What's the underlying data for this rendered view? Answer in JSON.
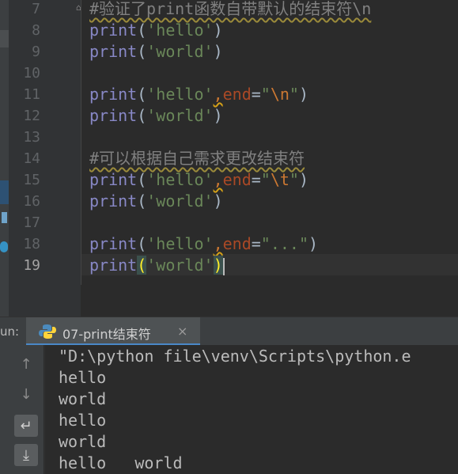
{
  "editor": {
    "lines": [
      {
        "num": "7",
        "parts": [
          {
            "t": "#验证了print函数自带默认的结束符\\n",
            "c": "cmt"
          }
        ]
      },
      {
        "num": "8",
        "parts": [
          {
            "t": "print",
            "c": "kw"
          },
          {
            "t": "(",
            "c": "par"
          },
          {
            "t": "'hello'",
            "c": "str"
          },
          {
            "t": ")",
            "c": "par"
          }
        ]
      },
      {
        "num": "9",
        "parts": [
          {
            "t": "print",
            "c": "kw"
          },
          {
            "t": "(",
            "c": "par"
          },
          {
            "t": "'world'",
            "c": "str"
          },
          {
            "t": ")",
            "c": "par"
          }
        ]
      },
      {
        "num": "10",
        "parts": []
      },
      {
        "num": "11",
        "parts": [
          {
            "t": "print",
            "c": "kw"
          },
          {
            "t": "(",
            "c": "par"
          },
          {
            "t": "'hello'",
            "c": "str"
          },
          {
            "t": ",",
            "c": "wavy-comma"
          },
          {
            "t": "end",
            "c": "prm"
          },
          {
            "t": "=",
            "c": "par"
          },
          {
            "t": "\"",
            "c": "str"
          },
          {
            "t": "\\n",
            "c": "esc"
          },
          {
            "t": "\"",
            "c": "str"
          },
          {
            "t": ")",
            "c": "par"
          }
        ]
      },
      {
        "num": "12",
        "parts": [
          {
            "t": "print",
            "c": "kw"
          },
          {
            "t": "(",
            "c": "par"
          },
          {
            "t": "'world'",
            "c": "str"
          },
          {
            "t": ")",
            "c": "par"
          }
        ]
      },
      {
        "num": "13",
        "parts": []
      },
      {
        "num": "14",
        "parts": [
          {
            "t": "#可以根据自己需求更改结束符",
            "c": "cmt"
          }
        ]
      },
      {
        "num": "15",
        "parts": [
          {
            "t": "print",
            "c": "kw"
          },
          {
            "t": "(",
            "c": "par"
          },
          {
            "t": "'hello'",
            "c": "str"
          },
          {
            "t": ",",
            "c": "wavy-comma"
          },
          {
            "t": "end",
            "c": "prm"
          },
          {
            "t": "=",
            "c": "par"
          },
          {
            "t": "\"",
            "c": "str"
          },
          {
            "t": "\\t",
            "c": "esc"
          },
          {
            "t": "\"",
            "c": "str"
          },
          {
            "t": ")",
            "c": "par"
          }
        ]
      },
      {
        "num": "16",
        "parts": [
          {
            "t": "print",
            "c": "kw"
          },
          {
            "t": "(",
            "c": "par"
          },
          {
            "t": "'world'",
            "c": "str"
          },
          {
            "t": ")",
            "c": "par"
          }
        ]
      },
      {
        "num": "17",
        "parts": []
      },
      {
        "num": "18",
        "parts": [
          {
            "t": "print",
            "c": "kw"
          },
          {
            "t": "(",
            "c": "par"
          },
          {
            "t": "'hello'",
            "c": "str"
          },
          {
            "t": ",",
            "c": "wavy-comma"
          },
          {
            "t": "end",
            "c": "prm"
          },
          {
            "t": "=",
            "c": "par"
          },
          {
            "t": "\"...\"",
            "c": "str"
          },
          {
            "t": ")",
            "c": "par"
          }
        ]
      },
      {
        "num": "19",
        "parts": [
          {
            "t": "print",
            "c": "kw"
          },
          {
            "t": "(",
            "c": "hl"
          },
          {
            "t": "'world'",
            "c": "str"
          },
          {
            "t": ")",
            "c": "hl"
          }
        ],
        "current": true
      }
    ]
  },
  "run_panel": {
    "label": "un:",
    "tab_title": "07-print结束符",
    "close_glyph": "×",
    "output": [
      "\"D:\\python file\\venv\\Scripts\\python.e",
      "hello",
      "world",
      "hello",
      "world",
      "hello   world"
    ]
  },
  "toolbar": {
    "up_icon": "↑",
    "down_icon": "↓",
    "wrap_icon": "↵",
    "scroll_icon": "⤓"
  }
}
